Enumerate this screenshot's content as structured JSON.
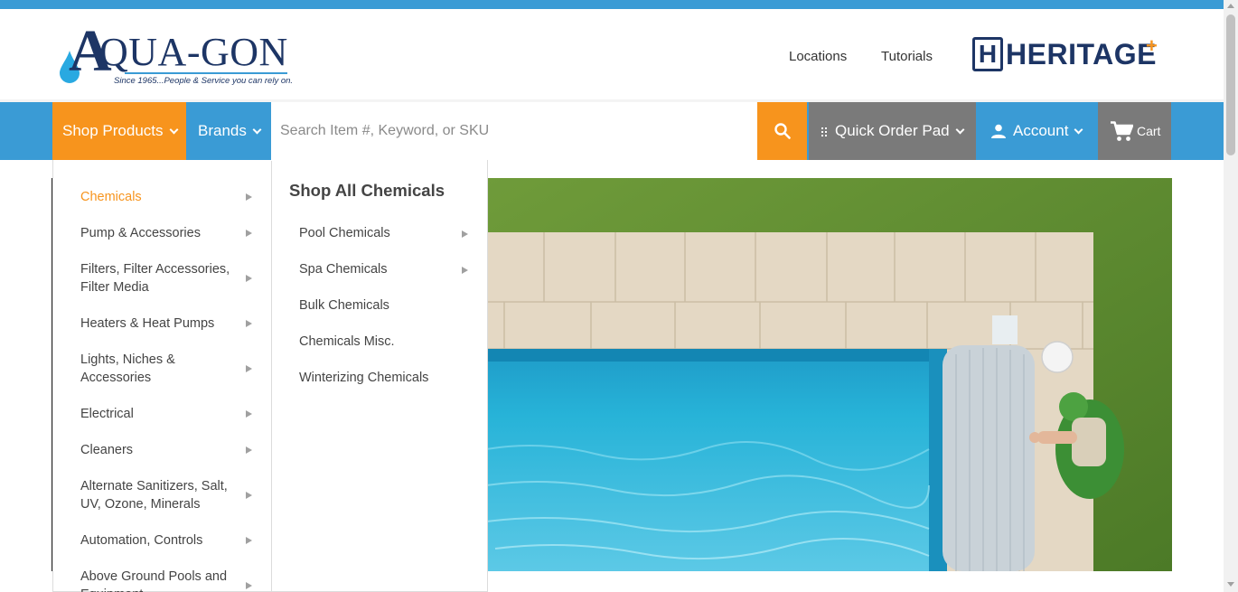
{
  "header": {
    "logo": {
      "name": "QUA-GON",
      "initial": "A",
      "tagline": "Since 1965...People & Service you can rely on."
    },
    "links": [
      "Locations",
      "Tutorials"
    ],
    "partner_logo": {
      "letter": "H",
      "text": "HERITAGE",
      "plus": "+"
    }
  },
  "nav": {
    "shop_products": "Shop Products",
    "brands": "Brands",
    "search_placeholder": "Search Item #, Keyword, or SKU",
    "quick_order": "Quick Order Pad",
    "account": "Account",
    "cart": "Cart"
  },
  "megamenu": {
    "categories": [
      {
        "label": "Chemicals",
        "active": true
      },
      {
        "label": "Pump & Accessories"
      },
      {
        "label": "Filters, Filter Accessories, Filter Media"
      },
      {
        "label": "Heaters & Heat Pumps"
      },
      {
        "label": "Lights, Niches & Accessories"
      },
      {
        "label": "Electrical"
      },
      {
        "label": "Cleaners"
      },
      {
        "label": "Alternate Sanitizers, Salt, UV, Ozone, Minerals"
      },
      {
        "label": "Automation, Controls"
      },
      {
        "label": "Above Ground Pools and Equipment"
      }
    ],
    "sub_title": "Shop All Chemicals",
    "sub_items": [
      "Pool Chemicals",
      "Spa Chemicals",
      "Bulk Chemicals",
      "Chemicals Misc.",
      "Winterizing Chemicals"
    ]
  },
  "colors": {
    "brand_blue": "#3a9bd5",
    "accent_orange": "#f7941d",
    "gray_button": "#7a7a7a",
    "logo_navy": "#1d3565"
  },
  "icons": [
    "water-drop-icon",
    "search-icon",
    "grid-icon",
    "user-icon",
    "cart-icon",
    "chevron-down-icon",
    "caret-right-icon"
  ]
}
